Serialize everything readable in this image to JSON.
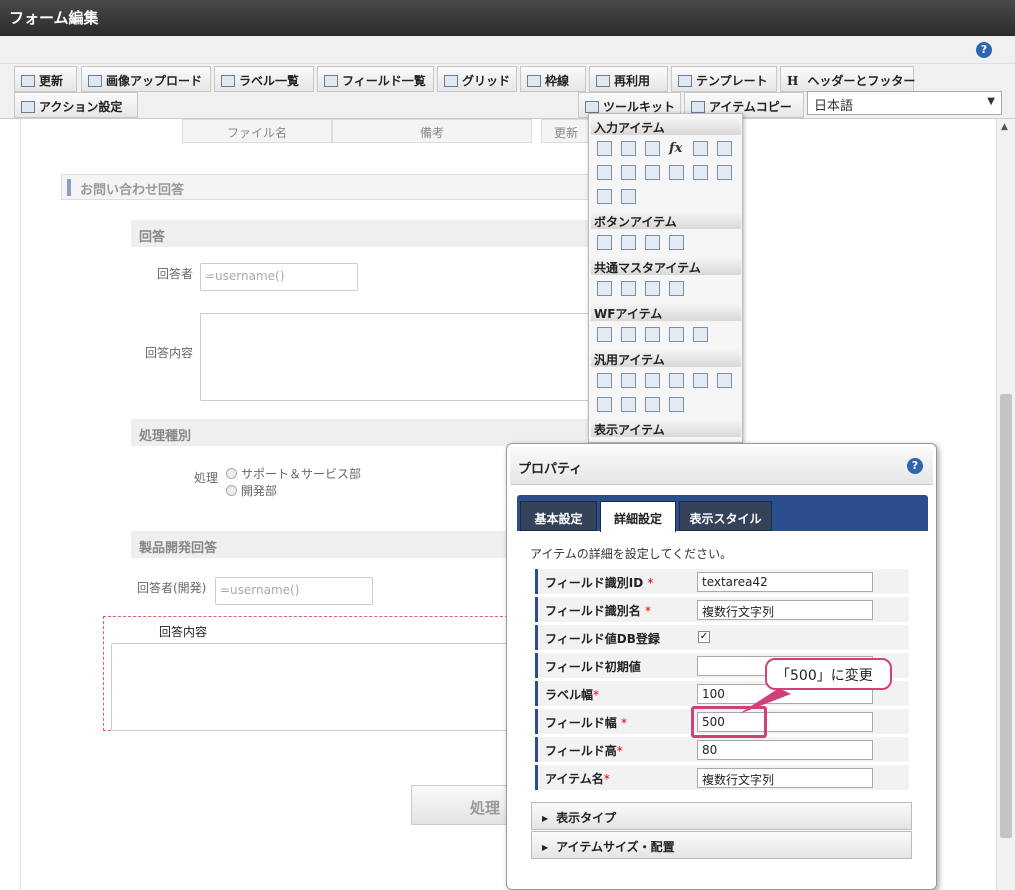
{
  "window": {
    "title": "フォーム編集"
  },
  "toolbar": {
    "row1": [
      "更新",
      "画像アップロード",
      "ラベル一覧",
      "フィールド一覧",
      "グリッド",
      "枠線",
      "再利用",
      "テンプレート",
      "ヘッダーとフッター"
    ],
    "row2_left": "アクション設定",
    "toolkit_label": "ツールキット",
    "item_copy_label": "アイテムコピー",
    "language": "日本語",
    "header_glyph": "H"
  },
  "canvas": {
    "col_headers": [
      "ファイル名",
      "備考",
      "更新"
    ],
    "main_section": "お問い合わせ回答",
    "section_answer": "回答",
    "answerer_label": "回答者",
    "answerer_value": "=username()",
    "answer_content_label": "回答内容",
    "section_processing": "処理種別",
    "processing_label": "処理",
    "radio_options": [
      "サポート＆サービス部",
      "開発部"
    ],
    "section_dev": "製品開発回答",
    "dev_answerer_label": "回答者(開発)",
    "dev_answerer_value": "=username()",
    "dev_content_label": "回答内容",
    "process_button": "処理"
  },
  "toolkit": {
    "groups": [
      "入力アイテム",
      "ボタンアイテム",
      "共通マスタアイテム",
      "WFアイテム",
      "汎用アイテム",
      "表示アイテム"
    ],
    "fx_glyph": "fx"
  },
  "properties": {
    "title": "プロパティ",
    "tabs": [
      "基本設定",
      "詳細設定",
      "表示スタイル"
    ],
    "description": "アイテムの詳細を設定してください。",
    "fields": [
      {
        "label": "フィールド識別ID",
        "required": true,
        "value": "textarea42"
      },
      {
        "label": "フィールド識別名",
        "required": true,
        "value": "複数行文字列"
      },
      {
        "label": "フィールド値DB登録",
        "required": false,
        "checked": true
      },
      {
        "label": "フィールド初期値",
        "required": false,
        "value": ""
      },
      {
        "label": "ラベル幅",
        "required": true,
        "value": "100"
      },
      {
        "label": "フィールド幅",
        "required": true,
        "value": "500"
      },
      {
        "label": "フィールド高",
        "required": true,
        "value": "80"
      },
      {
        "label": "アイテム名",
        "required": true,
        "value": "複数行文字列"
      }
    ],
    "accordions": [
      "表示タイプ",
      "アイテムサイズ・配置"
    ],
    "required_mark": "*",
    "check_mark": "✓"
  },
  "annotation": {
    "callout": "「500」に変更"
  },
  "colors": {
    "accent": "#2b4f8c",
    "highlight": "#d0407a"
  }
}
